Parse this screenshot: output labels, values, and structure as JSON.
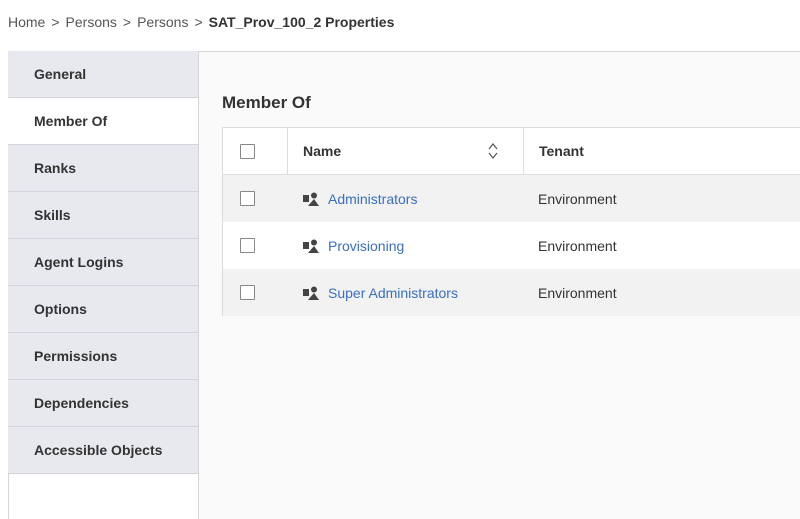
{
  "breadcrumb": {
    "items": [
      "Home",
      "Persons",
      "Persons"
    ],
    "separator": ">",
    "current": "SAT_Prov_100_2 Properties"
  },
  "sidebar": {
    "items": [
      {
        "label": "General",
        "active": false
      },
      {
        "label": "Member Of",
        "active": true
      },
      {
        "label": "Ranks",
        "active": false
      },
      {
        "label": "Skills",
        "active": false
      },
      {
        "label": "Agent Logins",
        "active": false
      },
      {
        "label": "Options",
        "active": false
      },
      {
        "label": "Permissions",
        "active": false
      },
      {
        "label": "Dependencies",
        "active": false
      },
      {
        "label": "Accessible Objects",
        "active": false
      }
    ]
  },
  "main": {
    "title": "Member Of",
    "table": {
      "columns": {
        "name": "Name",
        "tenant": "Tenant"
      },
      "rows": [
        {
          "name": "Administrators",
          "tenant": "Environment",
          "icon": "access-group-icon"
        },
        {
          "name": "Provisioning",
          "tenant": "Environment",
          "icon": "access-group-icon"
        },
        {
          "name": "Super Administrators",
          "tenant": "Environment",
          "icon": "access-group-icon"
        }
      ]
    }
  },
  "colors": {
    "link": "#3a6ec4",
    "sidebar_bg": "#e7e9ee",
    "row_alt": "#f2f2f2"
  }
}
